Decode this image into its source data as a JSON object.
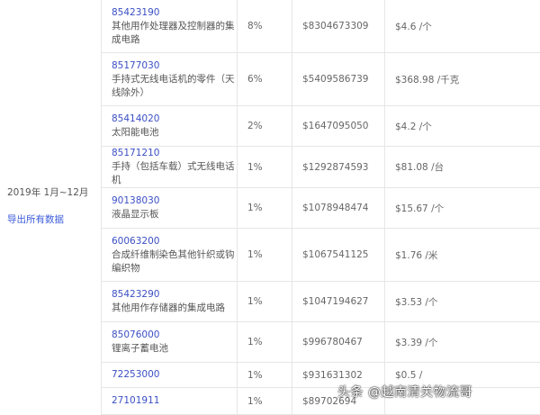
{
  "left": {
    "period": "2019年 1月~12月",
    "export_link": "导出所有数据"
  },
  "rows": [
    {
      "code": "85423190",
      "desc": "其他用作处理器及控制器的集成电路",
      "share": "8%",
      "value": "$8304673309",
      "unit_price": "$4.6 /个",
      "h": 59
    },
    {
      "code": "85177030",
      "desc": "手持式无线电话机的零件（天线除外）",
      "share": "6%",
      "value": "$5409586739",
      "unit_price": "$368.98 /千克",
      "h": 59
    },
    {
      "code": "85414020",
      "desc": "太阳能电池",
      "share": "2%",
      "value": "$1647095050",
      "unit_price": "$4.2 /个",
      "h": 45
    },
    {
      "code": "85171210",
      "desc": "手持（包括车载）式无线电话机",
      "share": "1%",
      "value": "$1292874593",
      "unit_price": "$81.08 /台",
      "h": 43
    },
    {
      "code": "90138030",
      "desc": "液晶显示板",
      "share": "1%",
      "value": "$1078948474",
      "unit_price": "$15.67 /个",
      "h": 45
    },
    {
      "code": "60063200",
      "desc": "合成纤维制染色其他针织或钩编织物",
      "share": "1%",
      "value": "$1067541125",
      "unit_price": "$1.76 /米",
      "h": 59
    },
    {
      "code": "85423290",
      "desc": "其他用作存储器的集成电路",
      "share": "1%",
      "value": "$1047194627",
      "unit_price": "$3.53 /个",
      "h": 45
    },
    {
      "code": "85076000",
      "desc": "锂离子蓄电池",
      "share": "1%",
      "value": "$996780467",
      "unit_price": "$3.39 /个",
      "h": 45
    },
    {
      "code": "72253000",
      "desc": "",
      "share": "1%",
      "value": "$931631302",
      "unit_price": "$0.5 /",
      "h": 28
    },
    {
      "code": "27101911",
      "desc": "",
      "share": "1%",
      "value": "$89702694",
      "unit_price": "",
      "h": 30
    }
  ],
  "watermark": "头条 @越南清关物流哥"
}
